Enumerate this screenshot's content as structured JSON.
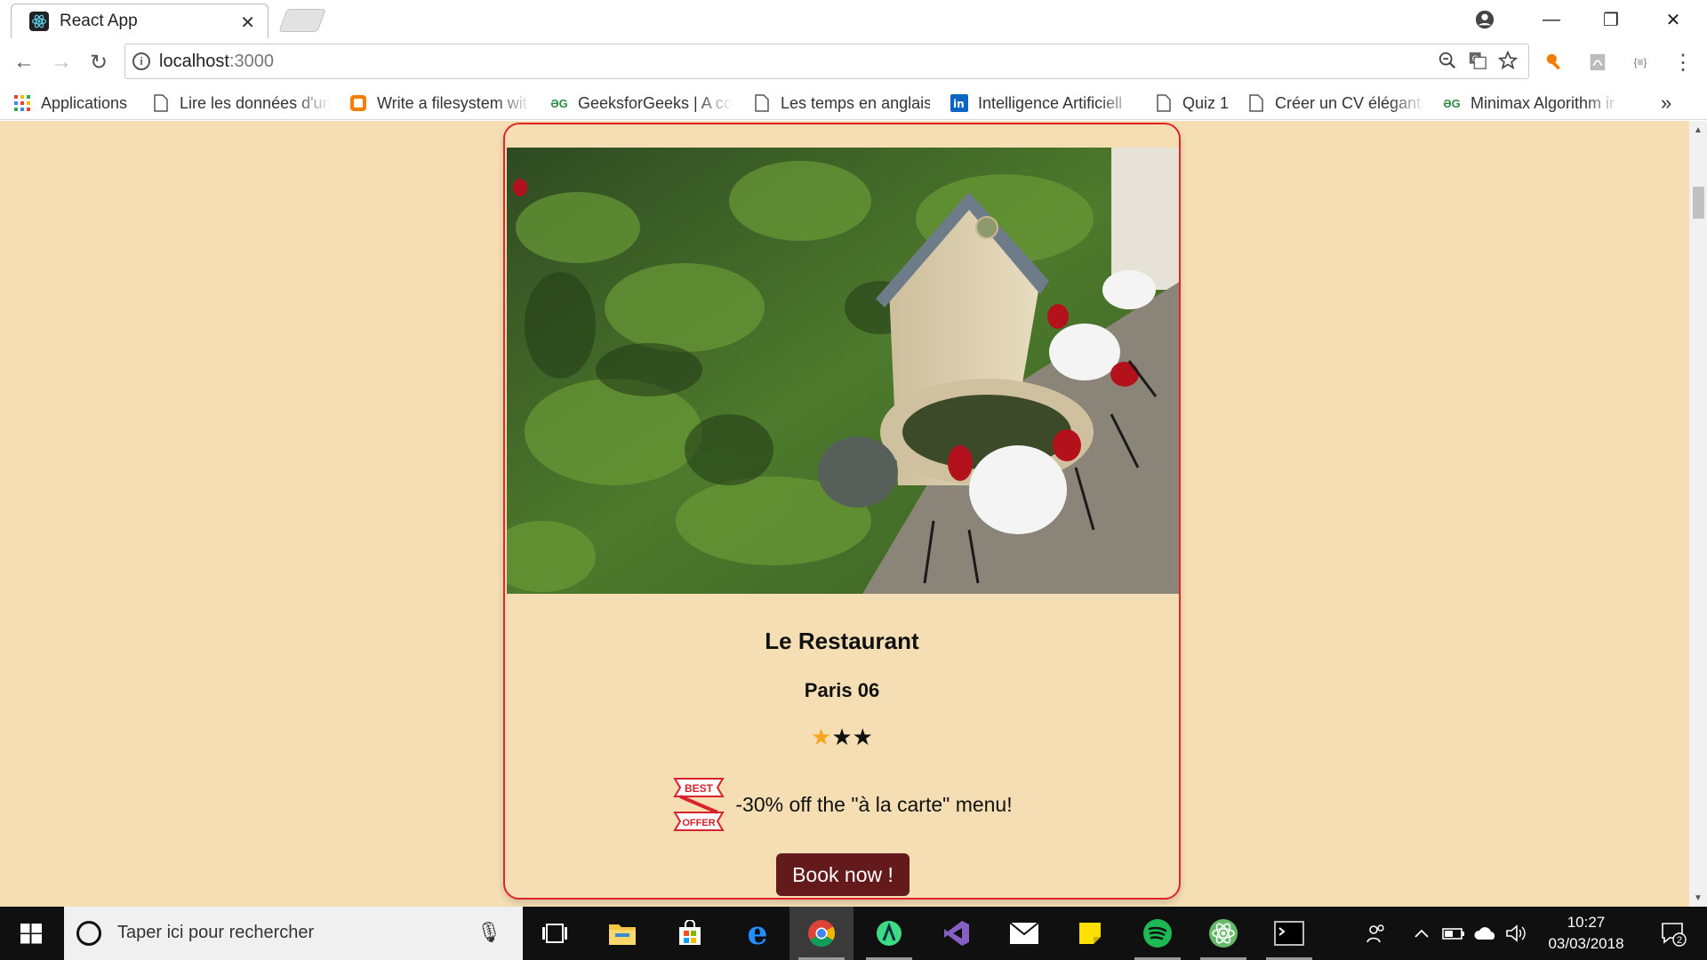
{
  "browser": {
    "tab": {
      "title": "React App",
      "favicon": "react-icon",
      "close_glyph": "✕"
    },
    "window_controls": {
      "minimize": "—",
      "restore": "❐",
      "close": "✕"
    },
    "toolbar": {
      "back": "←",
      "forward": "→",
      "reload": "↻",
      "url_host": "localhost",
      "url_port": ":3000",
      "omnibox_icons": [
        "zoom-icon",
        "translate-icon",
        "bookmark-star-icon"
      ],
      "extensions": [
        "key-extension-icon",
        "pdf-extension-icon",
        "json-extension-icon"
      ],
      "menu": "⋮"
    },
    "bookmarks": [
      {
        "label": "Applications",
        "icon": "apps-grid-icon"
      },
      {
        "label": "Lire les données d'un",
        "icon": "page-icon"
      },
      {
        "label": "Write a filesystem wit",
        "icon": "blogger-icon"
      },
      {
        "label": "GeeksforGeeks | A co",
        "icon": "geeksforgeeks-icon"
      },
      {
        "label": "Les temps en anglais",
        "icon": "page-icon"
      },
      {
        "label": "Intelligence Artificiell",
        "icon": "linkedin-icon"
      },
      {
        "label": "Quiz 1",
        "icon": "page-icon"
      },
      {
        "label": "Créer un CV élégant a",
        "icon": "page-icon"
      },
      {
        "label": "Minimax Algorithm ir",
        "icon": "geeksforgeeks-icon"
      }
    ],
    "bookmarks_overflow": "»"
  },
  "page": {
    "background_color": "#f5deb3",
    "card": {
      "border_color": "#e0242b",
      "image_alt": "restaurant courtyard with green wall and fountain",
      "title": "Le Restaurant",
      "location": "Paris 06",
      "rating": {
        "filled": 1,
        "total": 3
      },
      "offer_badge": {
        "top": "BEST",
        "bottom": "OFFER"
      },
      "offer_text": "-30% off the \"à la carte\" menu!",
      "button": "Book now !",
      "button_color": "#641a1a"
    }
  },
  "taskbar": {
    "search_placeholder": "Taper ici pour rechercher",
    "apps": [
      "task-view-icon",
      "file-explorer-icon",
      "store-icon",
      "edge-icon",
      "chrome-icon",
      "android-studio-icon",
      "visual-studio-icon",
      "mail-icon",
      "sticky-notes-icon",
      "spotify-icon",
      "atom-icon",
      "terminal-icon"
    ],
    "time": "10:27",
    "date": "03/03/2018",
    "notification_count": "2"
  }
}
